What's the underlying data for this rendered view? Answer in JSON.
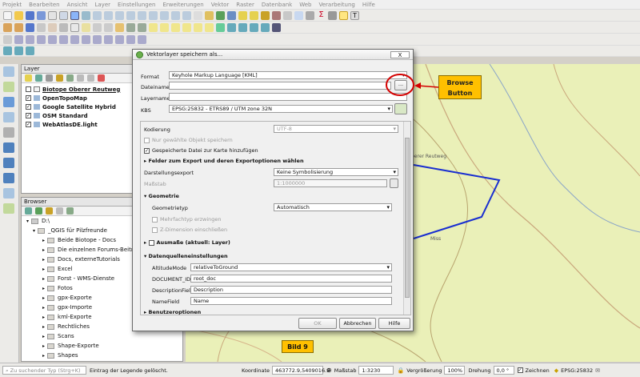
{
  "menu": [
    "Projekt",
    "Bearbeiten",
    "Ansicht",
    "Layer",
    "Einstellungen",
    "Erweiterungen",
    "Vektor",
    "Raster",
    "Datenbank",
    "Web",
    "Verarbeitung",
    "Hilfe"
  ],
  "layers_panel": {
    "title": "Layer",
    "layers": [
      {
        "name": "Biotope Oberer Reutweg",
        "checked": false
      },
      {
        "name": "OpenTopoMap",
        "checked": true
      },
      {
        "name": "Google Satellite Hybrid",
        "checked": true
      },
      {
        "name": "OSM Standard",
        "checked": true
      },
      {
        "name": "WebAtlasDE.light",
        "checked": true
      }
    ]
  },
  "browser_panel": {
    "title": "Browser",
    "items": [
      "D:\\",
      "_QGIS für Pilzfreunde",
      "Beide Biotope - Docs",
      "Die einzelnen Forums-Beiträ",
      "Docs, externeTutorials",
      "Excel",
      "Forst - WMS-Dienste",
      "Fotos",
      "gpx-Exporte",
      "gpx-Importe",
      "kml-Exporte",
      "Rechtliches",
      "Scans",
      "Shape-Exporte",
      "Shapes"
    ]
  },
  "dialog": {
    "title": "Vektorlayer speichern als...",
    "close": "X",
    "format_label": "Format",
    "format_value": "Keyhole Markup Language [KML]",
    "dateiname_label": "Dateiname",
    "dateiname_value": "",
    "browse": "...",
    "layername_label": "Layername",
    "layername_value": "",
    "kbs_label": "KBS",
    "kbs_value": "EPSG:25832 - ETRS89 / UTM zone 32N",
    "kodierung_label": "Kodierung",
    "kodierung_value": "UTF-8",
    "nur_gewaehlte": "Nur gewählte Objekt speichern",
    "gespeicherte": "Gespeicherte Datei zur Karte hinzufügen",
    "felder": "Felder zum Export und deren Exportoptionen wählen",
    "darstellung_label": "Darstellungsexport",
    "darstellung_value": "Keine Symbolisierung",
    "massstab_label": "Maßstab",
    "massstab_value": "1:1000000",
    "geometrie": "Geometrie",
    "geometrietyp_label": "Geometrietyp",
    "geometrietyp_value": "Automatisch",
    "mehrfachtyp": "Mehrfachtyp erzwingen",
    "z_dimension": "Z-Dimension einschließen",
    "ausmasse": "Ausmaße (aktuell: Layer)",
    "datenquellen": "Datenquelleneinstellungen",
    "altitude_label": "AltitudeMode",
    "altitude_value": "relativeToGround",
    "docid_label": "DOCUMENT_ID",
    "docid_value": "root_doc",
    "descfield_label": "DescriptionField",
    "descfield_value": "Description",
    "namefield_label": "NameField",
    "namefield_value": "Name",
    "benutzer": "Benutzeroptionen",
    "ok": "OK",
    "abbrechen": "Abbrechen",
    "hilfe": "Hilfe"
  },
  "map": {
    "label_reutweg": "berer Reutweg",
    "label_miss": "Miss"
  },
  "annotations": {
    "browse_callout": [
      "Browse",
      "Button"
    ],
    "bild": "Bild 9"
  },
  "statusbar": {
    "search_placeholder": "Zu suchender Typ (Strg+K)",
    "message": "Eintrag der Legende gelöscht.",
    "koordinate_label": "Koordinate",
    "koordinate_value": "463772.9,5409016.9",
    "massstab_label": "Maßstab",
    "massstab_value": "1:3230",
    "vergroesserung_label": "Vergrößerung",
    "vergroesserung_value": "100%",
    "drehung_label": "Drehung",
    "drehung_value": "0,0 °",
    "zeichnen_label": "Zeichnen",
    "crs_value": "EPSG:25832"
  },
  "colors": {
    "map_bg": "#eaf0b8",
    "callout": "#ffc000",
    "highlight_circle": "#d40000",
    "route": "#1a2fd0"
  }
}
